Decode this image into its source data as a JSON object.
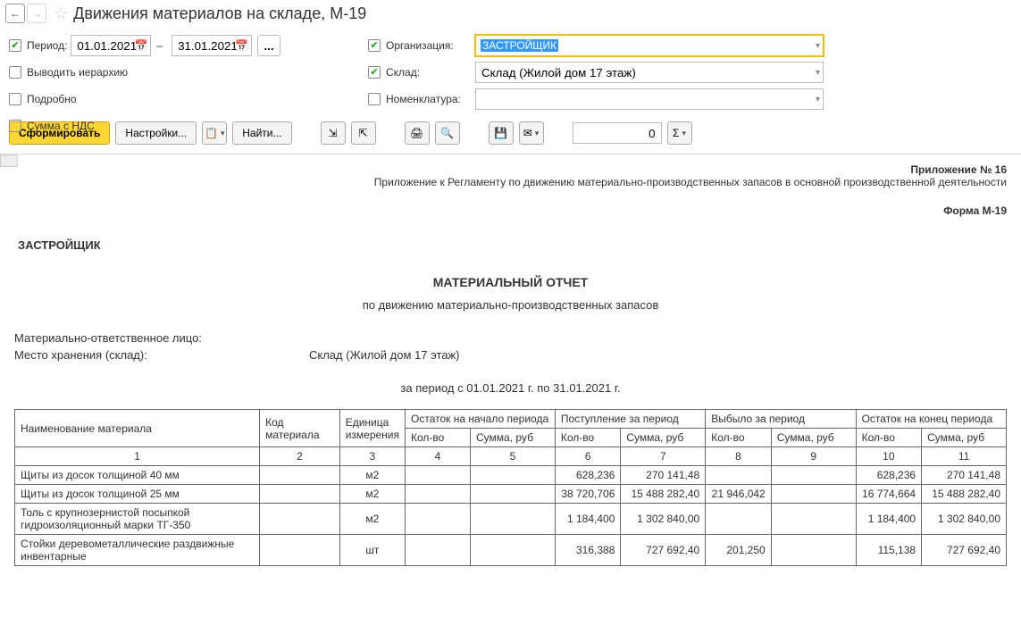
{
  "title": "Движения материалов на складе, М-19",
  "params": {
    "period_label": "Период:",
    "date_from": "01.01.2021",
    "date_to": "31.01.2021",
    "output_hierarchy": "Выводить иерархию",
    "detailed": "Подробно",
    "sum_with_vat": "Сумма с НДС",
    "org_label": "Организация:",
    "org_value": "ЗАСТРОЙЩИК",
    "warehouse_label": "Склад:",
    "warehouse_value": "Склад (Жилой дом 17 этаж)",
    "nomenclature_label": "Номенклатура:",
    "nomenclature_value": ""
  },
  "toolbar": {
    "generate": "Сформировать",
    "settings": "Настройки...",
    "find": "Найти...",
    "sum_value": "0"
  },
  "report": {
    "attachment_no": "Приложение № 16",
    "attachment_text": "Приложение к Регламенту по движению материально-производственных запасов в основной производственной деятельности",
    "form_no": "Форма М-19",
    "org": "ЗАСТРОЙЩИК",
    "heading": "МАТЕРИАЛЬНЫЙ ОТЧЕТ",
    "subheading": "по движению материально-производственных запасов",
    "responsible_lbl": "Материально-ответственное лицо:",
    "storage_lbl": "Место хранения (склад):",
    "storage_val": "Склад (Жилой дом 17 этаж)",
    "period_text": "за период с 01.01.2021 г. по 31.01.2021 г.",
    "columns": {
      "name": "Наименование материала",
      "code": "Код материала",
      "unit": "Единица измерения",
      "start": "Остаток на начало периода",
      "in": "Поступление за период",
      "out": "Выбыло за период",
      "end": "Остаток на конец периода",
      "qty": "Кол-во",
      "sum": "Сумма, руб"
    },
    "rows": [
      {
        "name": "Щиты из досок  толщиной 40 мм",
        "code": "",
        "unit": "м2",
        "sq": "",
        "ss": "",
        "iq": "628,236",
        "is": "270 141,48",
        "oq": "",
        "os": "",
        "eq": "628,236",
        "es": "270 141,48"
      },
      {
        "name": "Щиты из досок  толщиной 25 мм",
        "code": "",
        "unit": "м2",
        "sq": "",
        "ss": "",
        "iq": "38 720,706",
        "is": "15 488 282,40",
        "oq": "21 946,042",
        "os": "",
        "eq": "16 774,664",
        "es": "15 488 282,40"
      },
      {
        "name": "Толь с крупнозернистой посыпкой гидроизоляционный марки ТГ-350",
        "code": "",
        "unit": "м2",
        "sq": "",
        "ss": "",
        "iq": "1 184,400",
        "is": "1 302 840,00",
        "oq": "",
        "os": "",
        "eq": "1 184,400",
        "es": "1 302 840,00"
      },
      {
        "name": "Стойки деревометаллические раздвижные инвентарные",
        "code": "",
        "unit": "шт",
        "sq": "",
        "ss": "",
        "iq": "316,388",
        "is": "727 692,40",
        "oq": "201,250",
        "os": "",
        "eq": "115,138",
        "es": "727 692,40"
      }
    ]
  }
}
